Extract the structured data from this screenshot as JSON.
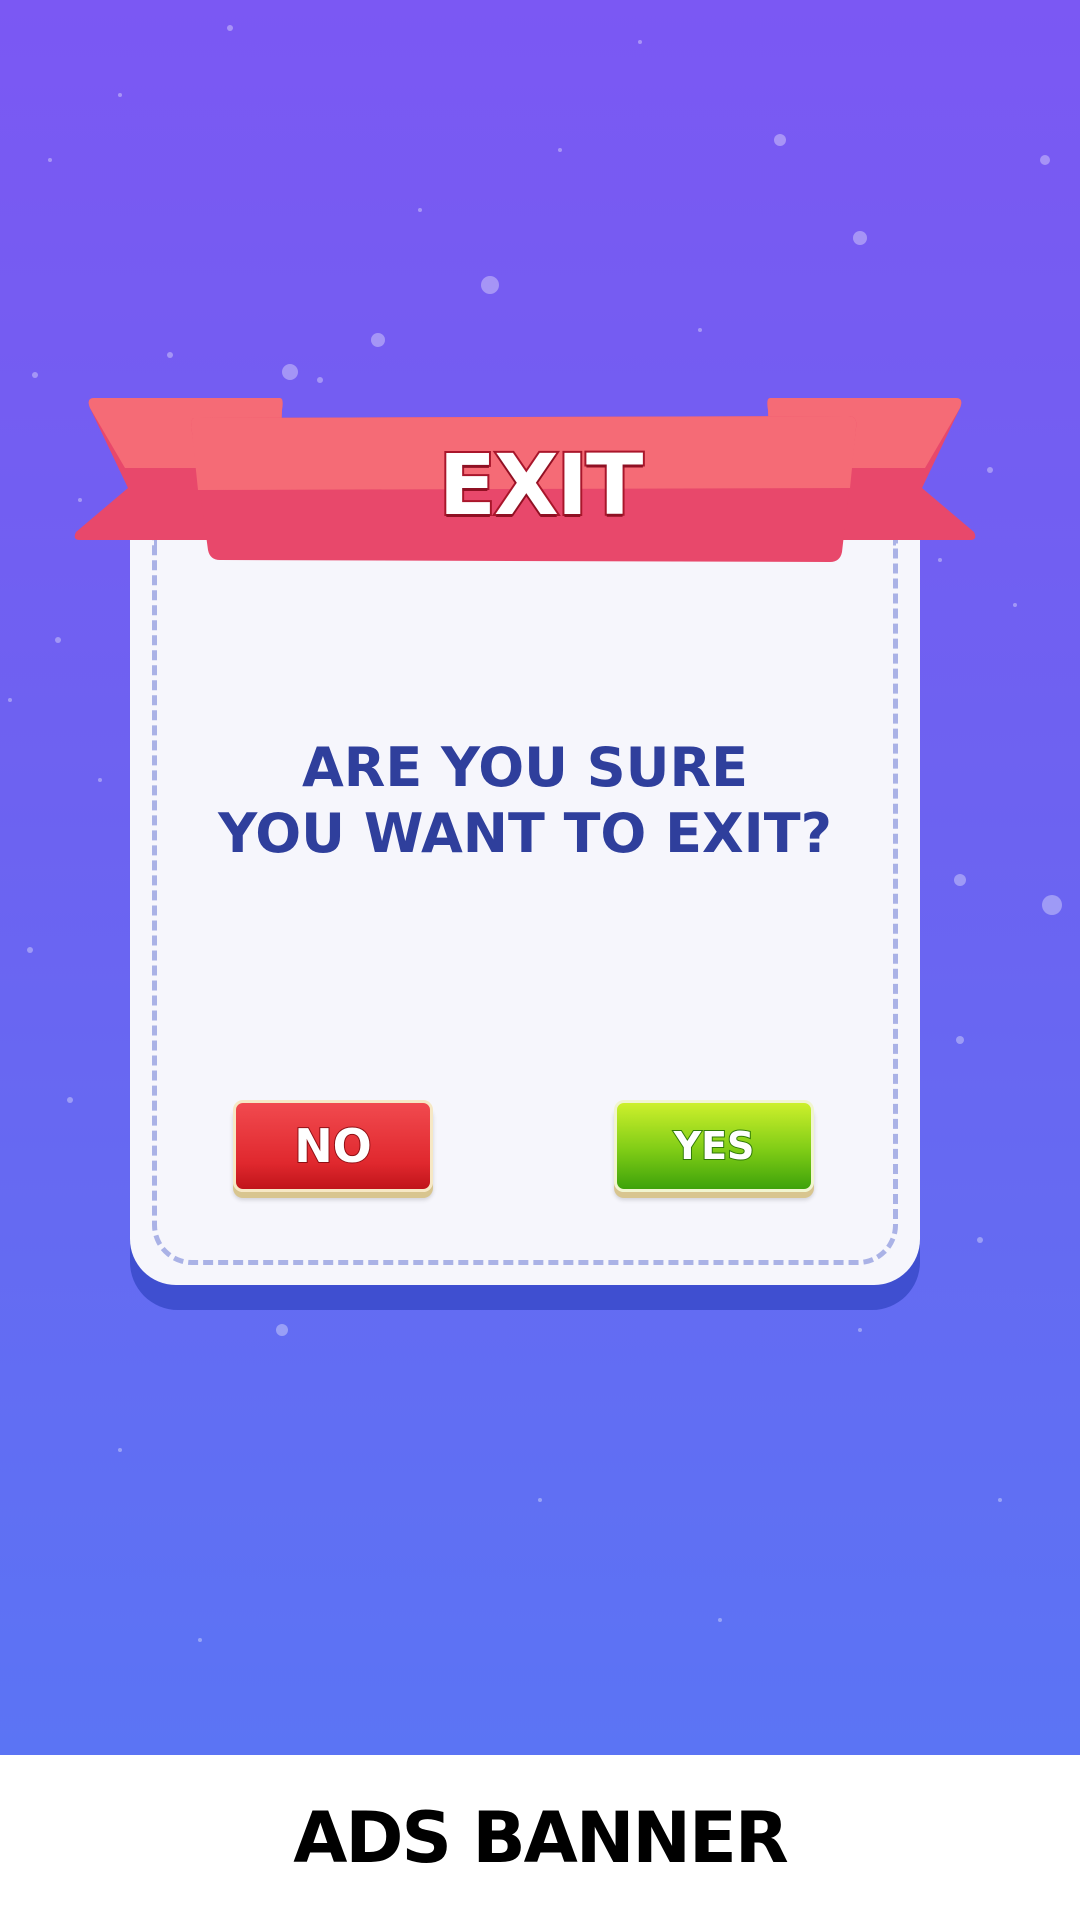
{
  "dialog": {
    "title": "EXIT",
    "question_line1": "ARE YOU SURE",
    "question_line2": "YOU WANT TO EXIT?",
    "no_label": "NO",
    "yes_label": "YES"
  },
  "ads_banner": {
    "label": "ADS BANNER"
  },
  "colors": {
    "background_top": "#7b58f3",
    "background_bottom": "#5b74f4",
    "ribbon_light": "#f56b76",
    "ribbon_dark": "#e8486b",
    "question_text": "#2f3f9c",
    "no_button": "#e0282e",
    "yes_button": "#7fcc16"
  }
}
